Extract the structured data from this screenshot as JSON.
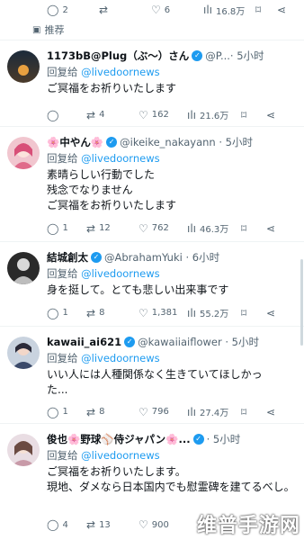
{
  "top_actions": {
    "reply": "2",
    "retweet": "",
    "like": "6",
    "views": "16.8万"
  },
  "reco_label": "推荐",
  "tweets": [
    {
      "name": "1173bB@Plug（ぶ～）さん",
      "handle": "@P...",
      "time": "· 5小时",
      "reply_prefix": "回复给",
      "reply_to": "@livedoornews",
      "lines": [
        "ご冥福をお祈りいたします"
      ],
      "replies": "",
      "retweets": "4",
      "likes": "162",
      "views": "21.6万"
    },
    {
      "name": "🌸中やん🌸",
      "handle": "@ikeike_nakayann · 5小时",
      "time": "",
      "reply_prefix": "回复给",
      "reply_to": "@livedoornews",
      "lines": [
        "素晴らしい行動でした",
        "残念でなりません",
        "ご冥福をお祈りいたします"
      ],
      "replies": "1",
      "retweets": "12",
      "likes": "762",
      "views": "46.3万"
    },
    {
      "name": "結城創太",
      "handle": "@AbrahamYuki · 6小时",
      "time": "",
      "reply_prefix": "回复给",
      "reply_to": "@livedoornews",
      "lines": [
        "身を挺して。とても悲しい出来事です"
      ],
      "replies": "1",
      "retweets": "8",
      "likes": "1,381",
      "views": "55.2万"
    },
    {
      "name": "kawaii_ai621",
      "handle": "@kawaiiaiflower · 5小时",
      "time": "",
      "reply_prefix": "回复给",
      "reply_to": "@livedoornews",
      "lines": [
        "いい人には人種関係なく生きていてほしかっ",
        "た..."
      ],
      "replies": "1",
      "retweets": "8",
      "likes": "796",
      "views": "27.4万"
    },
    {
      "name": "俊也🌸野球⚾侍ジャパン🌸...",
      "handle": "· 5小时",
      "time": "",
      "reply_prefix": "回复给",
      "reply_to": "@livedoornews",
      "lines": [
        "ご冥福をお祈りいたします。",
        "現地、ダメなら日本国内でも慰霊碑を建てるべし。"
      ],
      "replies": "4",
      "retweets": "13",
      "likes": "900",
      "views": ""
    }
  ],
  "watermark": "维普手游网"
}
